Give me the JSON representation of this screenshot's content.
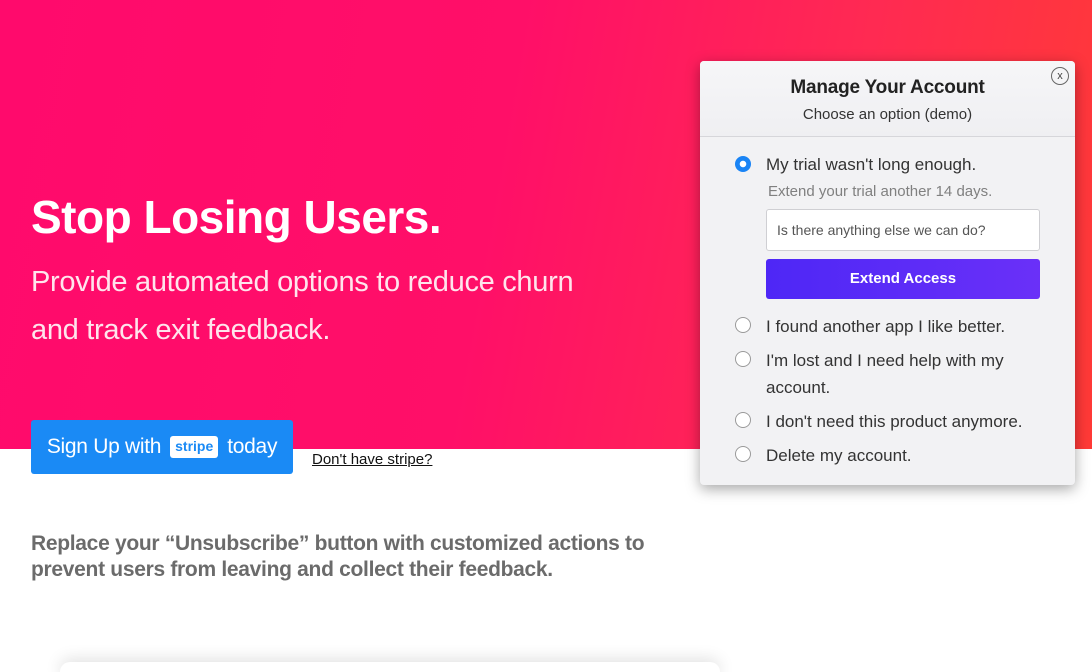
{
  "hero": {
    "headline": "Stop Losing Users.",
    "subhead": "Provide automated options to reduce churn and track exit feedback.",
    "signup": {
      "prefix": "Sign Up with",
      "badge": "stripe",
      "suffix": "today"
    },
    "no_stripe_link": "Don't have stripe?"
  },
  "tagline": "Replace your “Unsubscribe” button with customized actions to prevent users from leaving and collect their feedback.",
  "modal": {
    "title": "Manage Your Account",
    "subtitle": "Choose an option (demo)",
    "close_label": "x",
    "options": [
      {
        "label": "My trial wasn't long enough.",
        "checked": true
      },
      {
        "label": "I found another app I like better.",
        "checked": false
      },
      {
        "label": "I'm lost and I need help with my account.",
        "checked": false
      },
      {
        "label": "I don't need this product anymore.",
        "checked": false
      },
      {
        "label": "Delete my account.",
        "checked": false
      }
    ],
    "extend_note": "Extend your trial another 14 days.",
    "feedback_placeholder": "Is there anything else we can do?",
    "extend_button": "Extend Access"
  },
  "colors": {
    "hero_gradient_start": "#ff0a6c",
    "hero_gradient_end": "#ff3a36",
    "signup_button": "#1a8af5",
    "extend_button": "#5a2cf7",
    "radio_checked": "#1a84f5"
  }
}
